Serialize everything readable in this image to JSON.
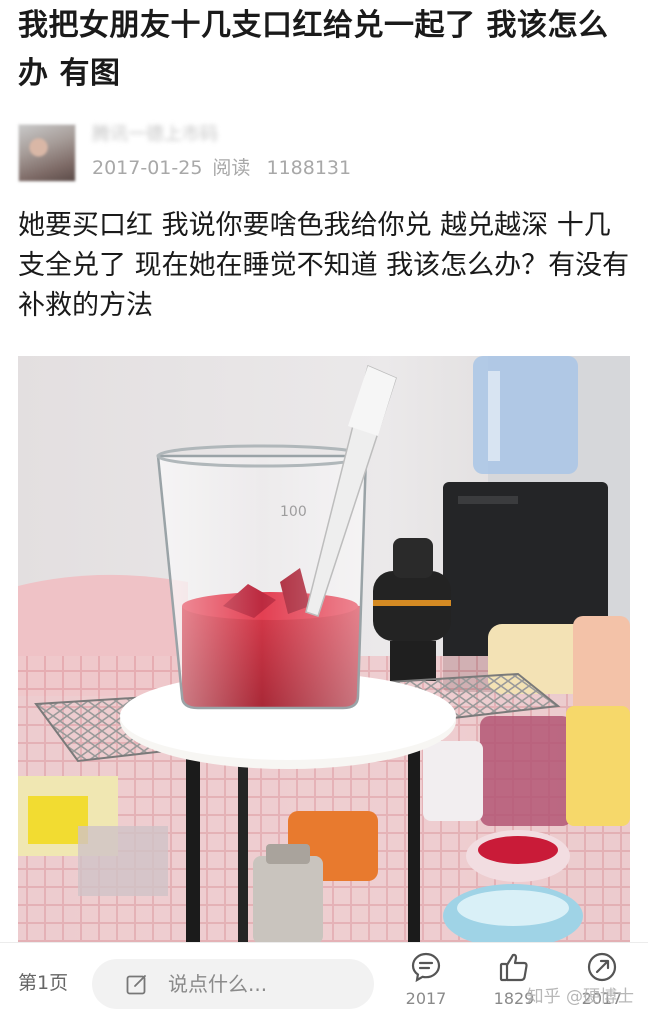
{
  "post": {
    "title": "我把女朋友十几支口红给兑一起了 我该怎么办 有图",
    "author": {
      "name": "腾讯一德上市码",
      "date": "2017-01-25",
      "reads_label": "阅读",
      "reads_count": "1188131"
    },
    "body": "她要买口红 我说你要啥色我给你兑 越兑越深 十几支全兑了 现在她在睡觉不知道 我该怎么办？有没有补救的方法",
    "image_desc": "beaker-with-melted-lipstick-photo"
  },
  "bottom_bar": {
    "page_label": "第1页",
    "comment_placeholder": "说点什么...",
    "comments_count": "2017",
    "likes_count": "1829",
    "shares_count": "2017"
  },
  "watermark": "知乎 @硬博士",
  "colors": {
    "text": "#1a1a1a",
    "meta": "#a8a8a8",
    "input_bg": "#f2f2f2",
    "icon": "#555555",
    "lipstick_red": "#c41a2e"
  }
}
